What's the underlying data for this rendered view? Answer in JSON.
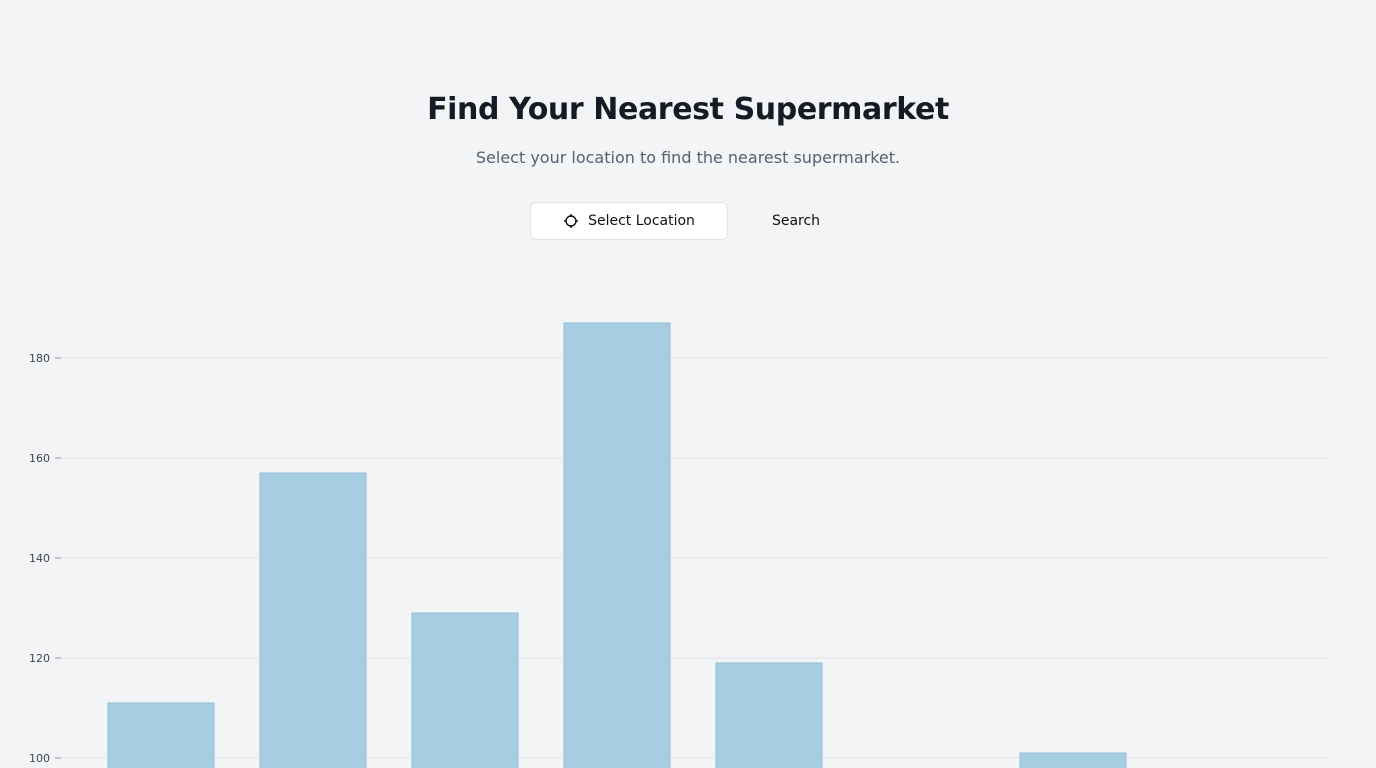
{
  "header": {
    "title": "Find Your Nearest Supermarket",
    "subtitle": "Select your location to find the nearest supermarket."
  },
  "actions": {
    "select_location_label": "Select Location",
    "select_location_icon": "crosshair-icon",
    "search_label": "Search"
  },
  "colors": {
    "background": "#f2f4f6",
    "bar_fill": "#a6cde1",
    "bar_stroke": "#94bdd3",
    "grid": "#e2e5e9"
  },
  "chart_data": {
    "type": "bar",
    "categories": [
      "",
      "",
      "",
      "",
      "",
      "",
      "",
      ""
    ],
    "values": [
      111,
      157,
      129,
      187,
      119,
      null,
      101,
      null
    ],
    "yticks": [
      100,
      120,
      140,
      160,
      180
    ],
    "grid": true
  }
}
